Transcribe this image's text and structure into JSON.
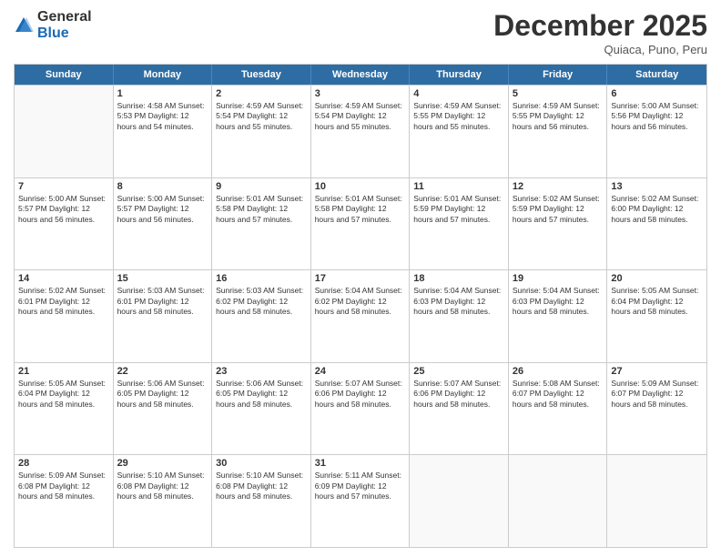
{
  "logo": {
    "general": "General",
    "blue": "Blue"
  },
  "title": "December 2025",
  "subtitle": "Quiaca, Puno, Peru",
  "days_of_week": [
    "Sunday",
    "Monday",
    "Tuesday",
    "Wednesday",
    "Thursday",
    "Friday",
    "Saturday"
  ],
  "weeks": [
    [
      {
        "day": "",
        "info": ""
      },
      {
        "day": "1",
        "info": "Sunrise: 4:58 AM\nSunset: 5:53 PM\nDaylight: 12 hours\nand 54 minutes."
      },
      {
        "day": "2",
        "info": "Sunrise: 4:59 AM\nSunset: 5:54 PM\nDaylight: 12 hours\nand 55 minutes."
      },
      {
        "day": "3",
        "info": "Sunrise: 4:59 AM\nSunset: 5:54 PM\nDaylight: 12 hours\nand 55 minutes."
      },
      {
        "day": "4",
        "info": "Sunrise: 4:59 AM\nSunset: 5:55 PM\nDaylight: 12 hours\nand 55 minutes."
      },
      {
        "day": "5",
        "info": "Sunrise: 4:59 AM\nSunset: 5:55 PM\nDaylight: 12 hours\nand 56 minutes."
      },
      {
        "day": "6",
        "info": "Sunrise: 5:00 AM\nSunset: 5:56 PM\nDaylight: 12 hours\nand 56 minutes."
      }
    ],
    [
      {
        "day": "7",
        "info": "Sunrise: 5:00 AM\nSunset: 5:57 PM\nDaylight: 12 hours\nand 56 minutes."
      },
      {
        "day": "8",
        "info": "Sunrise: 5:00 AM\nSunset: 5:57 PM\nDaylight: 12 hours\nand 56 minutes."
      },
      {
        "day": "9",
        "info": "Sunrise: 5:01 AM\nSunset: 5:58 PM\nDaylight: 12 hours\nand 57 minutes."
      },
      {
        "day": "10",
        "info": "Sunrise: 5:01 AM\nSunset: 5:58 PM\nDaylight: 12 hours\nand 57 minutes."
      },
      {
        "day": "11",
        "info": "Sunrise: 5:01 AM\nSunset: 5:59 PM\nDaylight: 12 hours\nand 57 minutes."
      },
      {
        "day": "12",
        "info": "Sunrise: 5:02 AM\nSunset: 5:59 PM\nDaylight: 12 hours\nand 57 minutes."
      },
      {
        "day": "13",
        "info": "Sunrise: 5:02 AM\nSunset: 6:00 PM\nDaylight: 12 hours\nand 58 minutes."
      }
    ],
    [
      {
        "day": "14",
        "info": "Sunrise: 5:02 AM\nSunset: 6:01 PM\nDaylight: 12 hours\nand 58 minutes."
      },
      {
        "day": "15",
        "info": "Sunrise: 5:03 AM\nSunset: 6:01 PM\nDaylight: 12 hours\nand 58 minutes."
      },
      {
        "day": "16",
        "info": "Sunrise: 5:03 AM\nSunset: 6:02 PM\nDaylight: 12 hours\nand 58 minutes."
      },
      {
        "day": "17",
        "info": "Sunrise: 5:04 AM\nSunset: 6:02 PM\nDaylight: 12 hours\nand 58 minutes."
      },
      {
        "day": "18",
        "info": "Sunrise: 5:04 AM\nSunset: 6:03 PM\nDaylight: 12 hours\nand 58 minutes."
      },
      {
        "day": "19",
        "info": "Sunrise: 5:04 AM\nSunset: 6:03 PM\nDaylight: 12 hours\nand 58 minutes."
      },
      {
        "day": "20",
        "info": "Sunrise: 5:05 AM\nSunset: 6:04 PM\nDaylight: 12 hours\nand 58 minutes."
      }
    ],
    [
      {
        "day": "21",
        "info": "Sunrise: 5:05 AM\nSunset: 6:04 PM\nDaylight: 12 hours\nand 58 minutes."
      },
      {
        "day": "22",
        "info": "Sunrise: 5:06 AM\nSunset: 6:05 PM\nDaylight: 12 hours\nand 58 minutes."
      },
      {
        "day": "23",
        "info": "Sunrise: 5:06 AM\nSunset: 6:05 PM\nDaylight: 12 hours\nand 58 minutes."
      },
      {
        "day": "24",
        "info": "Sunrise: 5:07 AM\nSunset: 6:06 PM\nDaylight: 12 hours\nand 58 minutes."
      },
      {
        "day": "25",
        "info": "Sunrise: 5:07 AM\nSunset: 6:06 PM\nDaylight: 12 hours\nand 58 minutes."
      },
      {
        "day": "26",
        "info": "Sunrise: 5:08 AM\nSunset: 6:07 PM\nDaylight: 12 hours\nand 58 minutes."
      },
      {
        "day": "27",
        "info": "Sunrise: 5:09 AM\nSunset: 6:07 PM\nDaylight: 12 hours\nand 58 minutes."
      }
    ],
    [
      {
        "day": "28",
        "info": "Sunrise: 5:09 AM\nSunset: 6:08 PM\nDaylight: 12 hours\nand 58 minutes."
      },
      {
        "day": "29",
        "info": "Sunrise: 5:10 AM\nSunset: 6:08 PM\nDaylight: 12 hours\nand 58 minutes."
      },
      {
        "day": "30",
        "info": "Sunrise: 5:10 AM\nSunset: 6:08 PM\nDaylight: 12 hours\nand 58 minutes."
      },
      {
        "day": "31",
        "info": "Sunrise: 5:11 AM\nSunset: 6:09 PM\nDaylight: 12 hours\nand 57 minutes."
      },
      {
        "day": "",
        "info": ""
      },
      {
        "day": "",
        "info": ""
      },
      {
        "day": "",
        "info": ""
      }
    ]
  ]
}
